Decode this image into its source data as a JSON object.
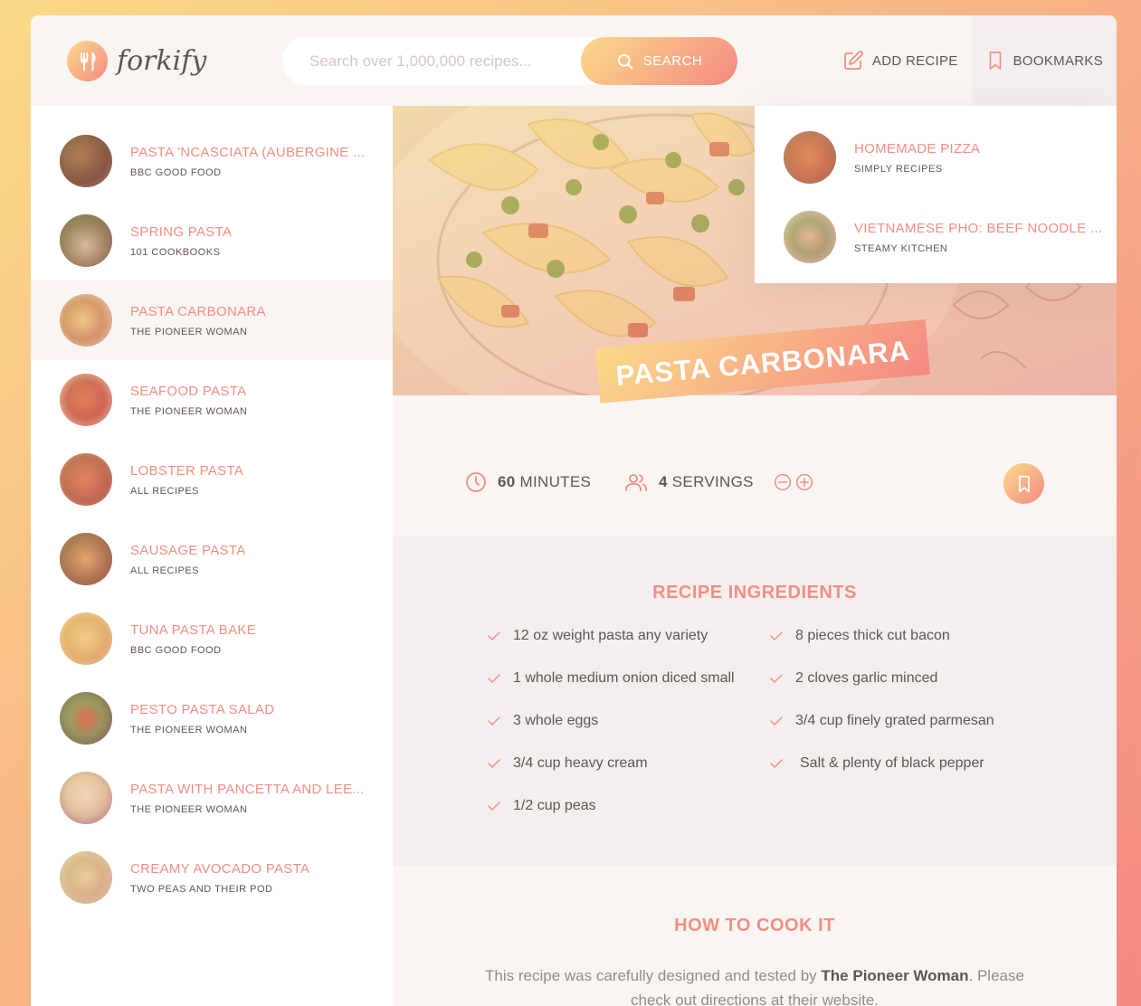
{
  "colors": {
    "accent": "#f38e82",
    "gradient_start": "#fbdb89",
    "gradient_end": "#f48982",
    "text_dark": "#615551",
    "bg_light": "#f9f5f3",
    "bg_mid": "#f2efee"
  },
  "header": {
    "logo_text": "forkify",
    "search_placeholder": "Search over 1,000,000 recipes...",
    "search_button": "SEARCH",
    "add_recipe": "ADD RECIPE",
    "bookmarks": "BOOKMARKS"
  },
  "results": [
    {
      "title": "PASTA 'NCASCIATA (AUBERGINE ...",
      "publisher": "BBC GOOD FOOD"
    },
    {
      "title": "SPRING PASTA",
      "publisher": "101 COOKBOOKS"
    },
    {
      "title": "PASTA CARBONARA",
      "publisher": "THE PIONEER WOMAN"
    },
    {
      "title": "SEAFOOD PASTA",
      "publisher": "THE PIONEER WOMAN"
    },
    {
      "title": "LOBSTER PASTA",
      "publisher": "ALL RECIPES"
    },
    {
      "title": "SAUSAGE PASTA",
      "publisher": "ALL RECIPES"
    },
    {
      "title": "TUNA PASTA BAKE",
      "publisher": "BBC GOOD FOOD"
    },
    {
      "title": "PESTO PASTA SALAD",
      "publisher": "THE PIONEER WOMAN"
    },
    {
      "title": "PASTA WITH PANCETTA AND LEE...",
      "publisher": "THE PIONEER WOMAN"
    },
    {
      "title": "CREAMY AVOCADO PASTA",
      "publisher": "TWO PEAS AND THEIR POD"
    }
  ],
  "bookmarks": [
    {
      "title": "HOMEMADE PIZZA",
      "publisher": "SIMPLY RECIPES"
    },
    {
      "title": "VIETNAMESE PHO: BEEF NOODLE ...",
      "publisher": "STEAMY KITCHEN"
    }
  ],
  "recipe": {
    "title": "PASTA CARBONARA",
    "minutes_value": "60",
    "minutes_label": "MINUTES",
    "servings_value": "4",
    "servings_label": "SERVINGS",
    "ingredients_title": "RECIPE INGREDIENTS",
    "ingredients": [
      "12 oz weight pasta any variety",
      "8 pieces thick cut bacon",
      "1 whole medium onion diced small",
      "2 cloves garlic minced",
      "3 whole eggs",
      "3/4 cup finely grated parmesan",
      "3/4 cup heavy cream",
      "Salt & plenty of black pepper",
      "1/2 cup peas"
    ],
    "directions_title": "HOW TO COOK IT",
    "directions_prefix": "This recipe was carefully designed and tested by ",
    "directions_publisher": "The Pioneer Woman",
    "directions_suffix": ". Please check out directions at their website."
  }
}
